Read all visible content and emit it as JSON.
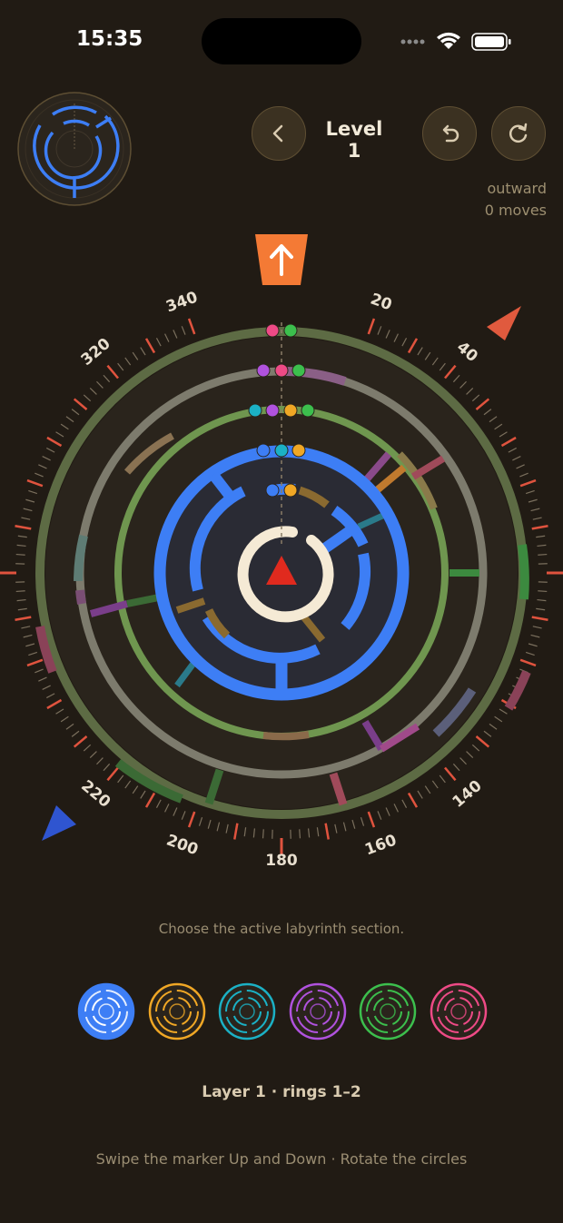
{
  "status": {
    "time": "15:35"
  },
  "header": {
    "level": "Level 1",
    "direction": "outward",
    "moves": "0 moves"
  },
  "dial": {
    "labels": [
      "20",
      "40",
      "140",
      "160",
      "180",
      "200",
      "220",
      "320",
      "340"
    ]
  },
  "instructions": {
    "choose": "Choose the active labyrinth section.",
    "layer": "Layer 1 · rings 1–2",
    "swipe": "Swipe the marker Up and Down · Rotate the circles"
  },
  "sections": [
    {
      "name": "blue",
      "color": "#3d7ef5",
      "selected": true
    },
    {
      "name": "orange",
      "color": "#f0a725",
      "selected": false
    },
    {
      "name": "cyan",
      "color": "#1bb1c5",
      "selected": false
    },
    {
      "name": "purple",
      "color": "#b052de",
      "selected": false
    },
    {
      "name": "green",
      "color": "#3cbf4d",
      "selected": false
    },
    {
      "name": "pink",
      "color": "#ee4a86",
      "selected": false
    }
  ],
  "icons": {
    "back": "chevron-left-icon",
    "undo": "undo-icon",
    "restart": "restart-icon",
    "marker": "arrow-up-icon"
  }
}
